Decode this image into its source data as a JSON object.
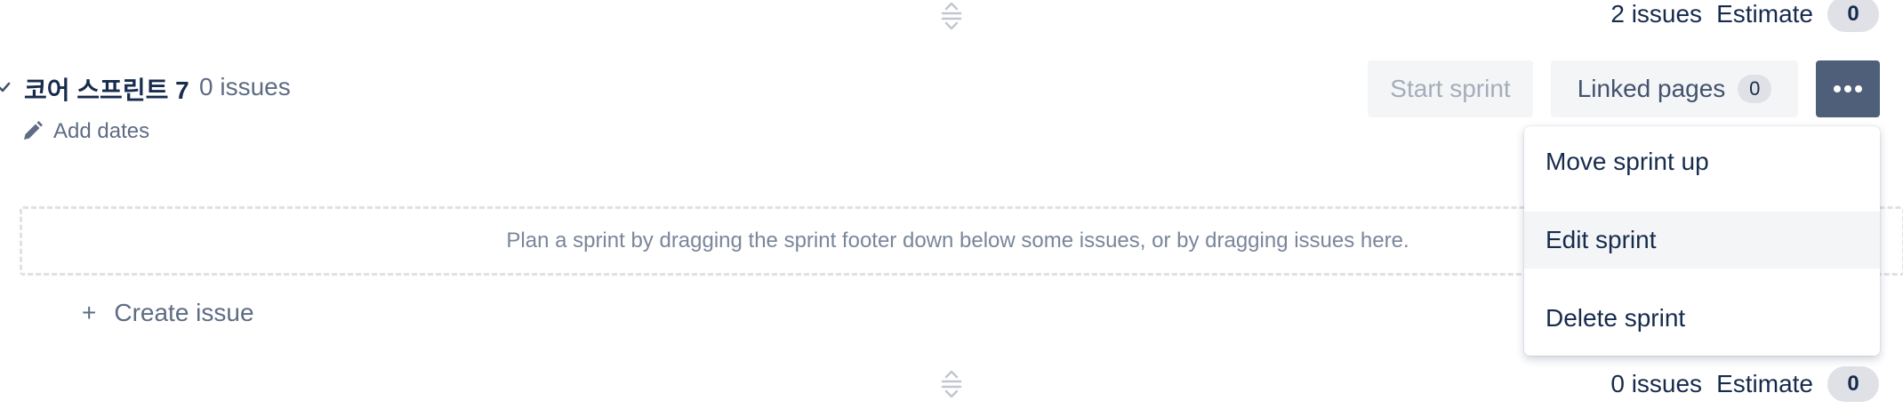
{
  "top_footer": {
    "issue_count": "2 issues",
    "estimate_label": "Estimate",
    "estimate_value": "0"
  },
  "sprint": {
    "title": "코어 스프린트 7",
    "issue_count": "0 issues",
    "add_dates_label": "Add dates",
    "start_sprint_label": "Start sprint",
    "linked_pages_label": "Linked pages",
    "linked_pages_count": "0",
    "drop_hint": "Plan a sprint by dragging the sprint footer down below some issues, or by dragging issues here.",
    "create_issue_plus": "+",
    "create_issue_label": "Create issue"
  },
  "menu": {
    "items": [
      {
        "label": "Move sprint up"
      },
      {
        "label": "Edit sprint"
      },
      {
        "label": "Delete sprint"
      }
    ]
  },
  "bottom_footer": {
    "issue_count": "0 issues",
    "estimate_label": "Estimate",
    "estimate_value": "0"
  },
  "icons": {
    "drag_handle": "drag-handle-icon",
    "chevron": "chevron-down-icon",
    "pencil": "pencil-icon",
    "more": "more-horizontal-icon"
  },
  "colors": {
    "more_button_bg": "#505f79",
    "text_primary": "#172b4d",
    "text_subtle": "#5e6c84",
    "pill_bg": "#dfe1e6"
  }
}
